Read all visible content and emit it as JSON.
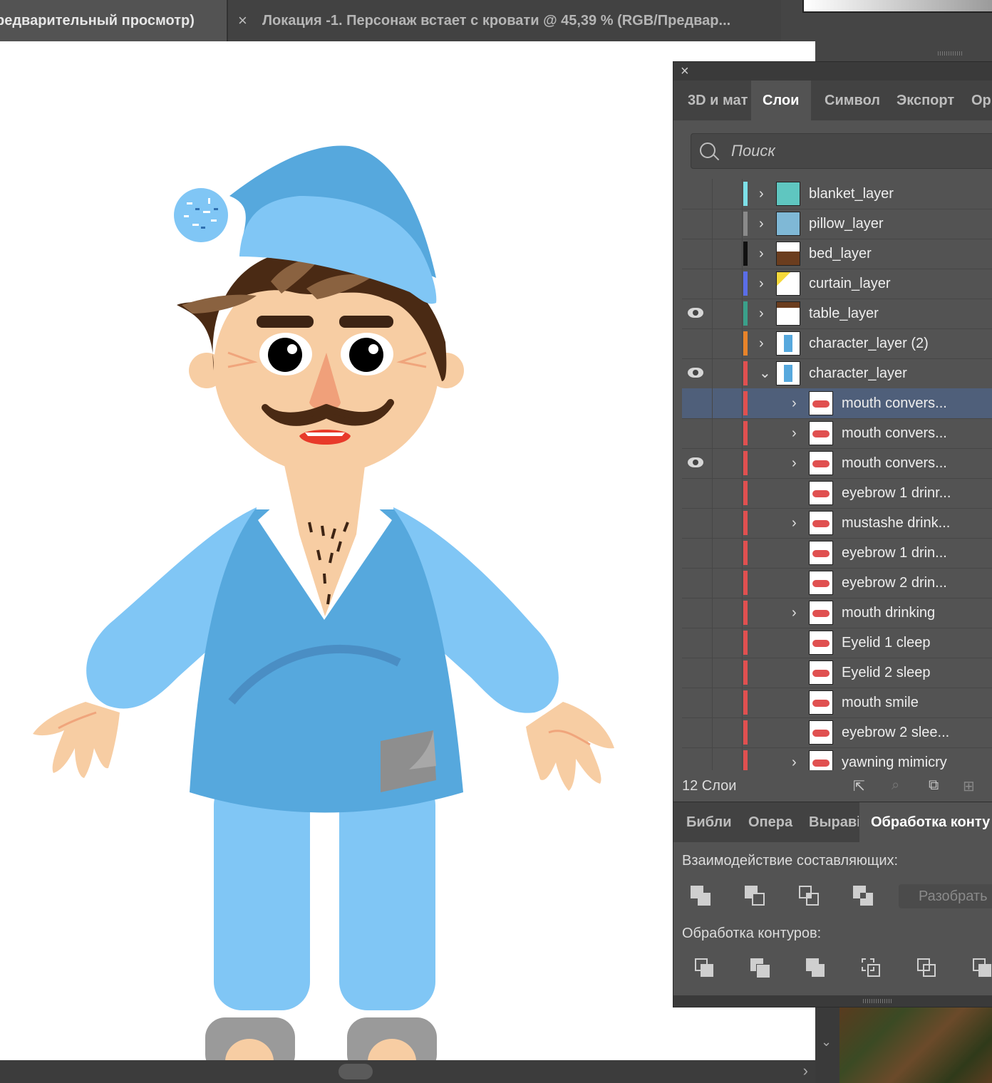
{
  "doc_tabs": [
    {
      "title": "редварительный просмотр)",
      "active": true
    },
    {
      "close": "×",
      "title": "Локация -1. Персонаж встает с кровати @ 45,39 % (RGB/Предвар...",
      "active": false
    }
  ],
  "panel": {
    "close": "×",
    "tabs": [
      "3D и мат",
      "Слои",
      "Символ",
      "Экспорт",
      "Ор"
    ],
    "active_tab": "Слои",
    "search_placeholder": "Поиск",
    "layers": [
      {
        "name": "blanket_layer",
        "color": "#7de0e8",
        "visible": false,
        "expandable": true,
        "indent": 0
      },
      {
        "name": "pillow_layer",
        "color": "#8a8a8a",
        "visible": false,
        "expandable": true,
        "indent": 0
      },
      {
        "name": "bed_layer",
        "color": "#111111",
        "visible": false,
        "expandable": true,
        "indent": 0
      },
      {
        "name": "curtain_layer",
        "color": "#5a6ee8",
        "visible": false,
        "expandable": true,
        "indent": 0
      },
      {
        "name": "table_layer",
        "color": "#3aa08a",
        "visible": true,
        "expandable": true,
        "indent": 0
      },
      {
        "name": "character_layer (2)",
        "color": "#e8842a",
        "visible": false,
        "expandable": true,
        "indent": 0
      },
      {
        "name": "character_layer",
        "color": "#e05050",
        "visible": true,
        "expandable": true,
        "expanded": true,
        "indent": 0
      },
      {
        "name": "mouth convers...",
        "color": "#e05050",
        "visible": false,
        "expandable": true,
        "indent": 1,
        "selected": true
      },
      {
        "name": "mouth convers...",
        "color": "#e05050",
        "visible": false,
        "expandable": true,
        "indent": 1
      },
      {
        "name": "mouth convers...",
        "color": "#e05050",
        "visible": true,
        "expandable": true,
        "indent": 1
      },
      {
        "name": "eyebrow 1 drinr...",
        "color": "#e05050",
        "visible": false,
        "expandable": false,
        "indent": 1
      },
      {
        "name": "mustashe drink...",
        "color": "#e05050",
        "visible": false,
        "expandable": true,
        "indent": 1
      },
      {
        "name": "eyebrow 1 drin...",
        "color": "#e05050",
        "visible": false,
        "expandable": false,
        "indent": 1
      },
      {
        "name": "eyebrow 2 drin...",
        "color": "#e05050",
        "visible": false,
        "expandable": false,
        "indent": 1
      },
      {
        "name": "mouth drinking",
        "color": "#e05050",
        "visible": false,
        "expandable": true,
        "indent": 1
      },
      {
        "name": "Eyelid 1 cleep",
        "color": "#e05050",
        "visible": false,
        "expandable": false,
        "indent": 1
      },
      {
        "name": "Eyelid 2 sleep",
        "color": "#e05050",
        "visible": false,
        "expandable": false,
        "indent": 1
      },
      {
        "name": "mouth smile",
        "color": "#e05050",
        "visible": false,
        "expandable": false,
        "indent": 1
      },
      {
        "name": "eyebrow 2 slee...",
        "color": "#e05050",
        "visible": false,
        "expandable": false,
        "indent": 1
      },
      {
        "name": "yawning mimicry",
        "color": "#e05050",
        "visible": false,
        "expandable": true,
        "indent": 1
      }
    ],
    "footer_count": "12 Слои",
    "tabs2": [
      "Библи",
      "Опера",
      "Выраві",
      "Обработка конту"
    ],
    "active_tab2": "Обработка конту",
    "shape_modes_label": "Взаимодействие составляющих:",
    "expand_button": "Разобрать",
    "pathfinders_label": "Обработка контуров:"
  }
}
